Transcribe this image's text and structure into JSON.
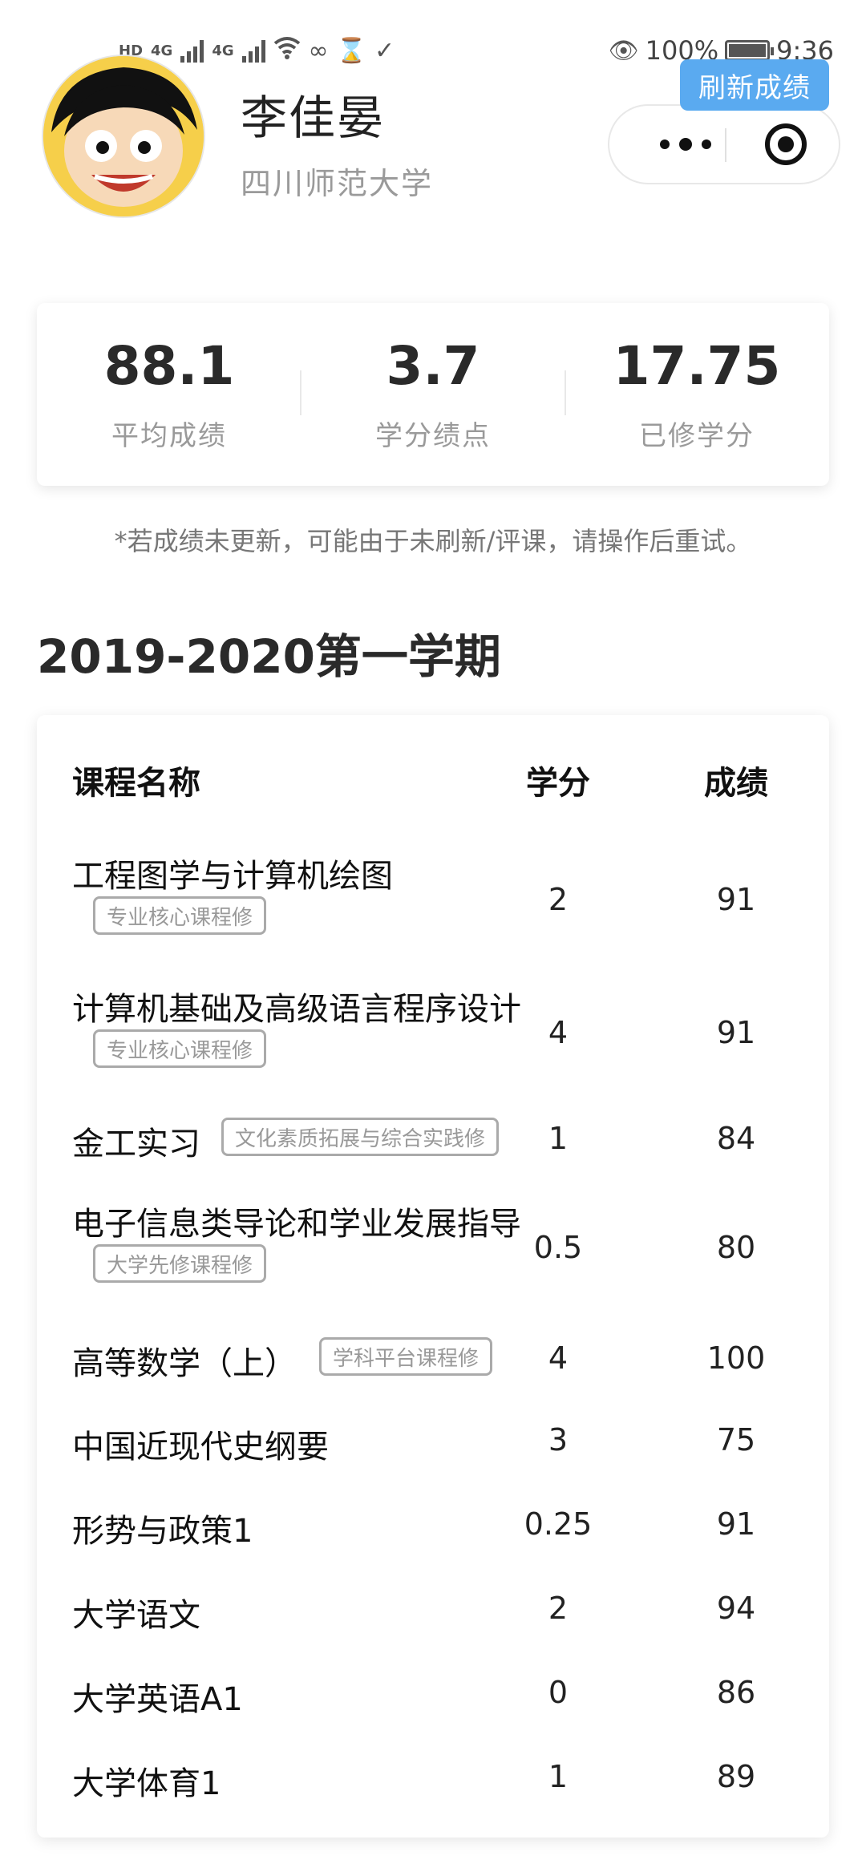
{
  "status_bar": {
    "hd_label": "HD",
    "net1_label": "4G",
    "net2_label": "4G",
    "battery_percent": "100%",
    "time": "9:36"
  },
  "header": {
    "name": "李佳晏",
    "school": "四川师范大学",
    "refresh_label": "刷新成绩"
  },
  "stats": {
    "avg": {
      "value": "88.1",
      "label": "平均成绩"
    },
    "gpa": {
      "value": "3.7",
      "label": "学分绩点"
    },
    "credits": {
      "value": "17.75",
      "label": "已修学分"
    }
  },
  "note": "*若成绩未更新，可能由于未刷新/评课，请操作后重试。",
  "term": {
    "title": "2019-2020第一学期",
    "headers": {
      "course": "课程名称",
      "credit": "学分",
      "score": "成绩"
    },
    "courses": [
      {
        "name": "工程图学与计算机绘图",
        "tag": "专业核心课程修",
        "credit": "2",
        "score": "91"
      },
      {
        "name": "计算机基础及高级语言程序设计",
        "tag": "专业核心课程修",
        "credit": "4",
        "score": "91"
      },
      {
        "name": "金工实习",
        "tag": "文化素质拓展与综合实践修",
        "credit": "1",
        "score": "84"
      },
      {
        "name": "电子信息类导论和学业发展指导",
        "tag": "大学先修课程修",
        "credit": "0.5",
        "score": "80"
      },
      {
        "name": "高等数学（上）",
        "tag": "学科平台课程修",
        "credit": "4",
        "score": "100"
      },
      {
        "name": "中国近现代史纲要",
        "credit": "3",
        "score": "75"
      },
      {
        "name": "形势与政策1",
        "credit": "0.25",
        "score": "91"
      },
      {
        "name": "大学语文",
        "credit": "2",
        "score": "94"
      },
      {
        "name": "大学英语A1",
        "credit": "0",
        "score": "86"
      },
      {
        "name": "大学体育1",
        "credit": "1",
        "score": "89"
      }
    ]
  },
  "colors": {
    "accent": "#5aaaf0",
    "text": "#222222",
    "muted": "#9a9a9a"
  }
}
